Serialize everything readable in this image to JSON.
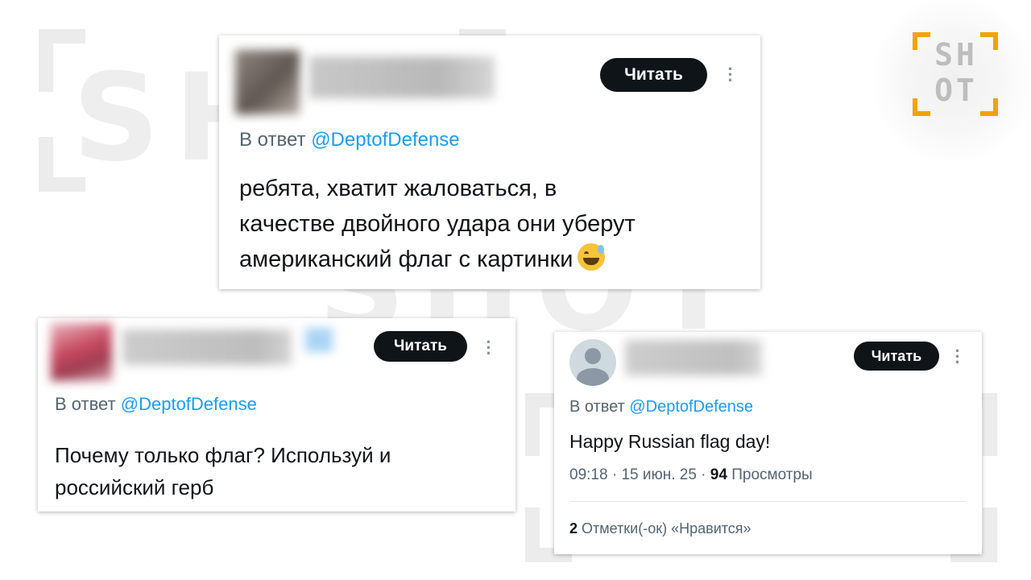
{
  "brand": {
    "logo_top": "SH",
    "logo_bottom": "OT",
    "accent": "#f2a300"
  },
  "watermark": {
    "text": "SHOT",
    "color": "#e6e6e6"
  },
  "posts": [
    {
      "read_label": "Читать",
      "reply_prefix": "В ответ",
      "reply_handle": "@DeptofDefense",
      "text_lines": [
        "ребята, хватит жаловаться, в",
        "качестве двойного удара они уберут",
        "американский флаг с картинки"
      ],
      "emoji": "grinning-face-with-sweat-emoji"
    },
    {
      "read_label": "Читать",
      "reply_prefix": "В ответ",
      "reply_handle": "@DeptofDefense",
      "text_lines": [
        "Почему только флаг? Используй и",
        "российский герб"
      ]
    },
    {
      "read_label": "Читать",
      "reply_prefix": "В ответ",
      "reply_handle": "@DeptofDefense",
      "text": "Happy Russian flag day!",
      "time": "09:18",
      "date": "15 июн. 25",
      "views_count": "94",
      "views_label": "Просмотры",
      "likes_count": "2",
      "likes_label": "Отметки(-ок) «Нравится»"
    }
  ],
  "colors": {
    "text": "#0f1419",
    "muted": "#536471",
    "link": "#1d9bf0",
    "button": "#0f1419"
  }
}
